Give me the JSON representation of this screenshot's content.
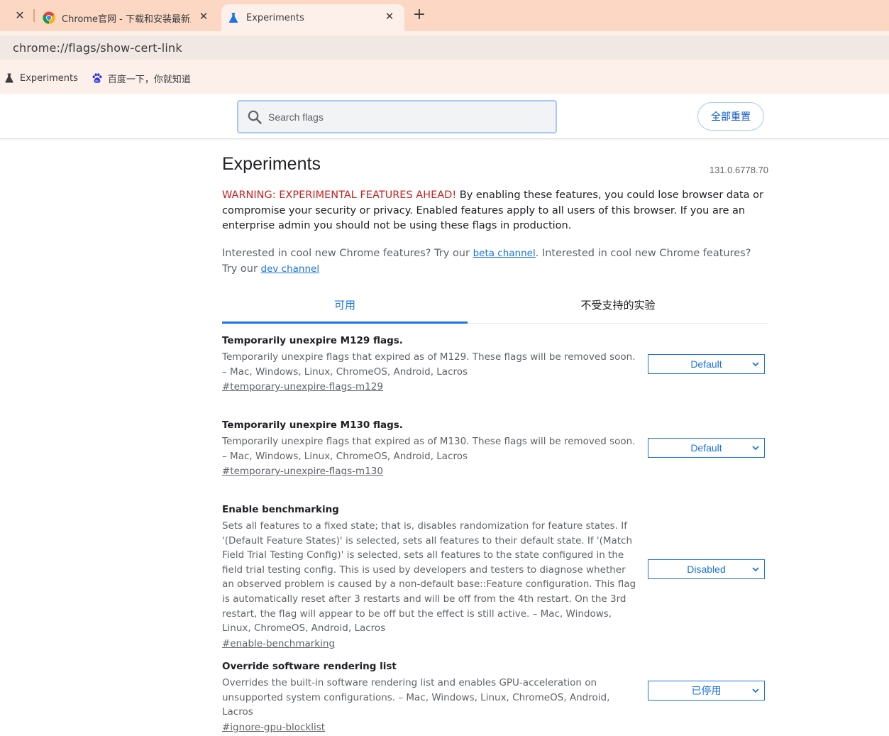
{
  "tabstrip": {
    "tabs": [
      {
        "title": "Chrome官网 - 下载和安装最新版"
      },
      {
        "title": "Experiments"
      }
    ],
    "close_glyph": "✕",
    "new_tab_glyph": "+"
  },
  "omnibox": {
    "url": "chrome://flags/show-cert-link"
  },
  "bookmarks": [
    {
      "label": "Experiments",
      "icon": "flask-icon"
    },
    {
      "label": "百度一下，你就知道",
      "icon": "baidu-paw-icon"
    }
  ],
  "flags_header": {
    "search_placeholder": "Search flags",
    "reset_label": "全部重置"
  },
  "page": {
    "title": "Experiments",
    "version": "131.0.6778.70",
    "warning_red": "WARNING: EXPERIMENTAL FEATURES AHEAD!",
    "warning_rest": " By enabling these features, you could lose browser data or compromise your security or privacy. Enabled features apply to all users of this browser. If you are an enterprise admin you should not be using these flags in production.",
    "promo_1": "Interested in cool new Chrome features? Try our ",
    "promo_link_1": "beta channel",
    "promo_2": ". Interested in cool new Chrome features? Try our ",
    "promo_link_2": "dev channel",
    "tabs": [
      "可用",
      "不受支持的实验"
    ]
  },
  "flags": [
    {
      "name": "Temporarily unexpire M129 flags.",
      "description": "Temporarily unexpire flags that expired as of M129. These flags will be removed soon. – Mac, Windows, Linux, ChromeOS, Android, Lacros",
      "link": "#temporary-unexpire-flags-m129",
      "value": "Default"
    },
    {
      "name": "Temporarily unexpire M130 flags.",
      "description": "Temporarily unexpire flags that expired as of M130. These flags will be removed soon. – Mac, Windows, Linux, ChromeOS, Android, Lacros",
      "link": "#temporary-unexpire-flags-m130",
      "value": "Default"
    },
    {
      "name": "Enable benchmarking",
      "description": "Sets all features to a fixed state; that is, disables randomization for feature states. If '(Default Feature States)' is selected, sets all features to their default state. If '(Match Field Trial Testing Config)' is selected, sets all features to the state configured in the field trial testing config. This is used by developers and testers to diagnose whether an observed problem is caused by a non-default base::Feature configuration. This flag is automatically reset after 3 restarts and will be off from the 4th restart. On the 3rd restart, the flag will appear to be off but the effect is still active. – Mac, Windows, Linux, ChromeOS, Android, Lacros",
      "link": "#enable-benchmarking",
      "value": "Disabled"
    },
    {
      "name": "Override software rendering list",
      "description": "Overrides the built-in software rendering list and enables GPU-acceleration on unsupported system configurations. – Mac, Windows, Linux, ChromeOS, Android, Lacros",
      "link": "#ignore-gpu-blocklist",
      "value": "已停用"
    }
  ],
  "colors": {
    "tabstrip_bg": "#fbd7c4",
    "accent_blue": "#1a73e8",
    "warning_red": "#c5221f"
  }
}
